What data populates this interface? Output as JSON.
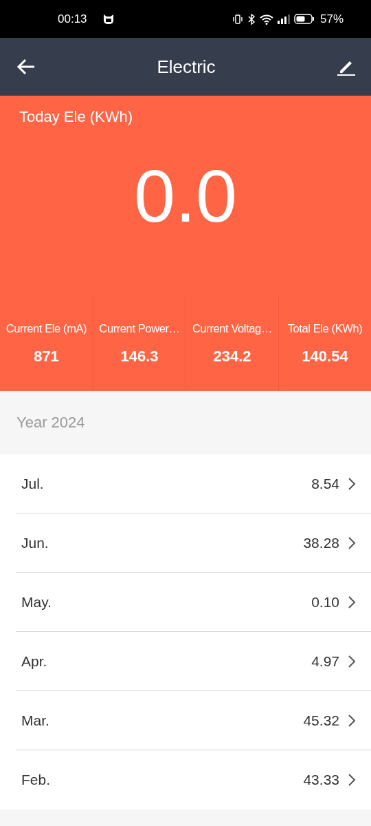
{
  "status_bar": {
    "time": "00:13",
    "battery": "57%"
  },
  "header": {
    "title": "Electric"
  },
  "today": {
    "label": "Today Ele (KWh)",
    "value": "0.0"
  },
  "stats": [
    {
      "label": "Current Ele (mA)",
      "value": "871"
    },
    {
      "label": "Current Power…",
      "value": "146.3"
    },
    {
      "label": "Current Voltag…",
      "value": "234.2"
    },
    {
      "label": "Total Ele (KWh)",
      "value": "140.54"
    }
  ],
  "year": "Year 2024",
  "months": [
    {
      "name": "Jul.",
      "value": "8.54"
    },
    {
      "name": "Jun.",
      "value": "38.28"
    },
    {
      "name": "May.",
      "value": "0.10"
    },
    {
      "name": "Apr.",
      "value": "4.97"
    },
    {
      "name": "Mar.",
      "value": "45.32"
    },
    {
      "name": "Feb.",
      "value": "43.33"
    }
  ]
}
